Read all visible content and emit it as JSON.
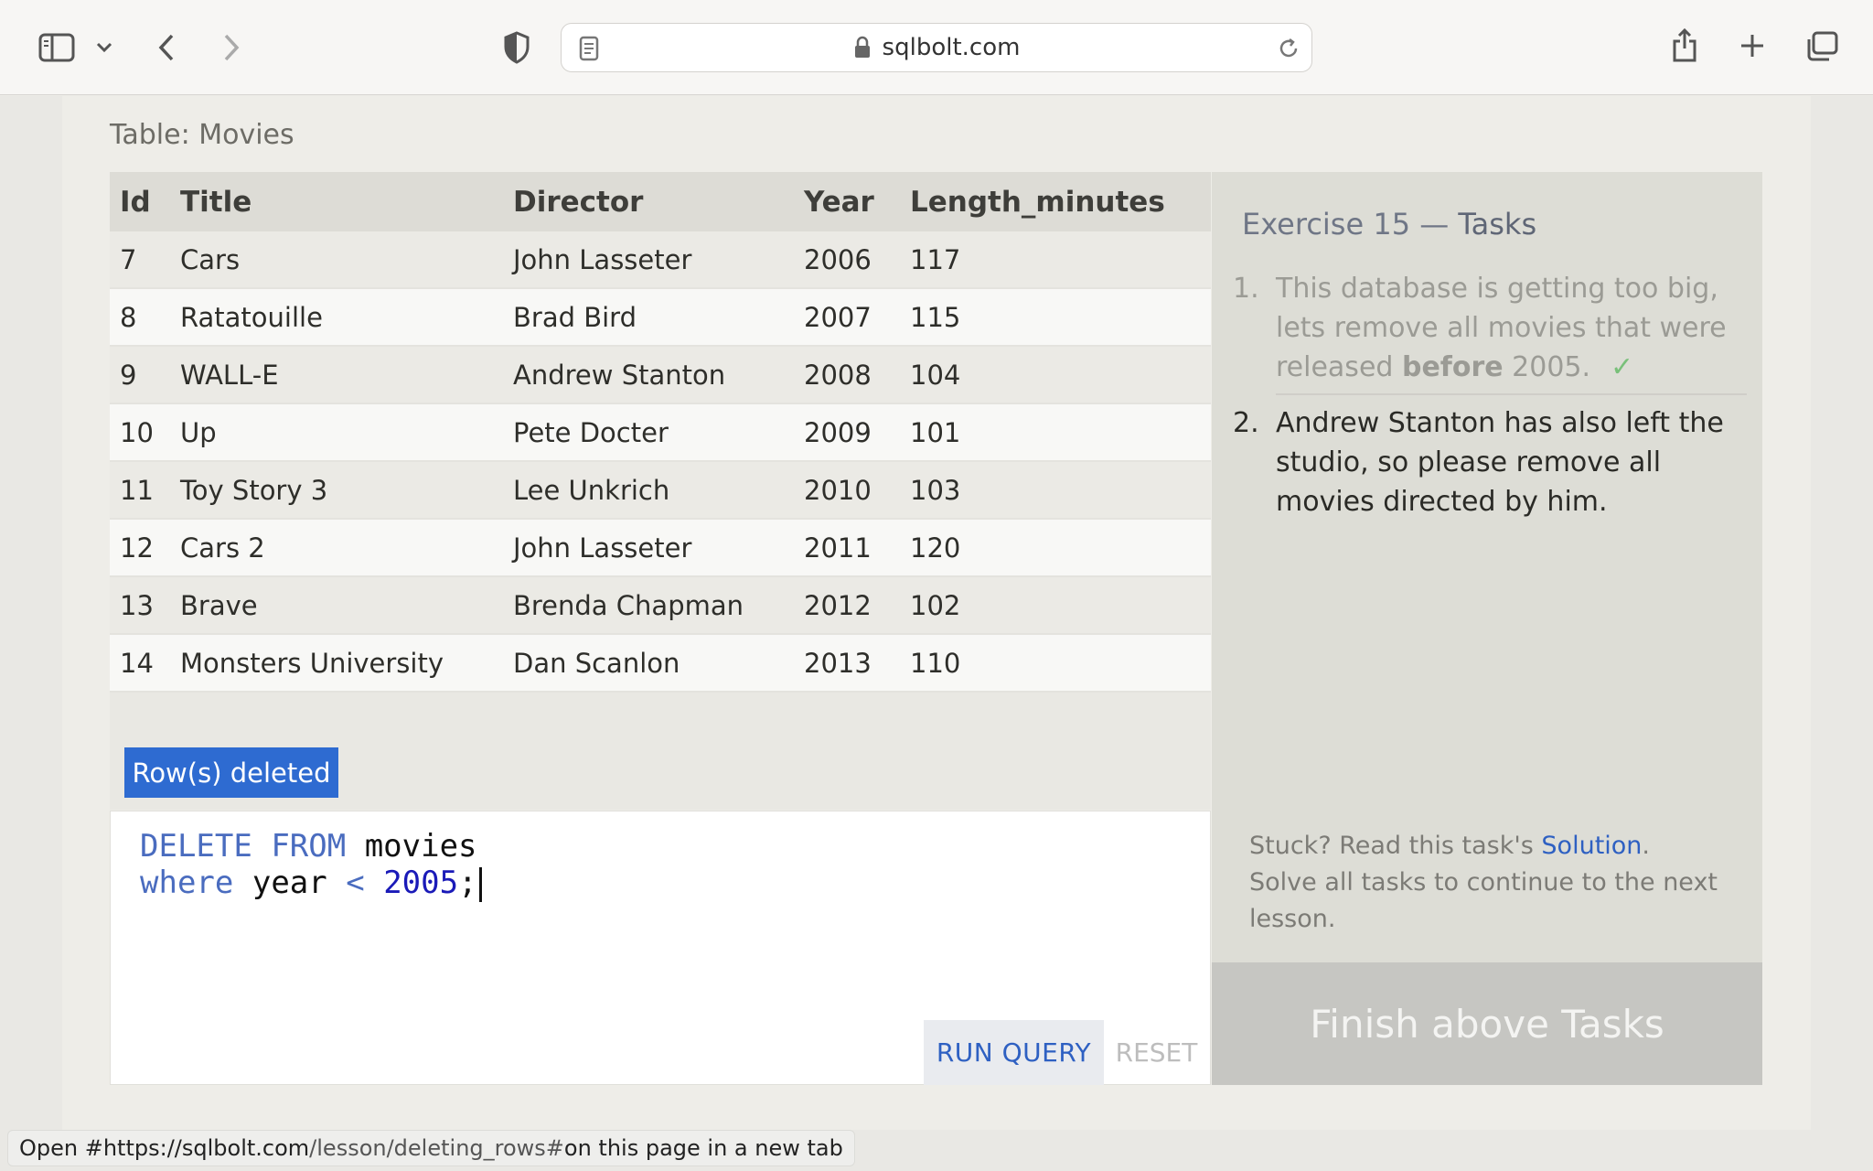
{
  "browser": {
    "url": "sqlbolt.com",
    "icons": [
      "sidebar-icon",
      "chevron-down-icon",
      "back-icon",
      "forward-icon",
      "shield-icon",
      "reader-icon",
      "lock-icon",
      "reload-icon",
      "share-icon",
      "new-tab-icon",
      "tabs-overview-icon"
    ]
  },
  "table": {
    "caption": "Table: Movies",
    "columns": [
      "Id",
      "Title",
      "Director",
      "Year",
      "Length_minutes"
    ],
    "rows": [
      [
        "7",
        "Cars",
        "John Lasseter",
        "2006",
        "117"
      ],
      [
        "8",
        "Ratatouille",
        "Brad Bird",
        "2007",
        "115"
      ],
      [
        "9",
        "WALL-E",
        "Andrew Stanton",
        "2008",
        "104"
      ],
      [
        "10",
        "Up",
        "Pete Docter",
        "2009",
        "101"
      ],
      [
        "11",
        "Toy Story 3",
        "Lee Unkrich",
        "2010",
        "103"
      ],
      [
        "12",
        "Cars 2",
        "John Lasseter",
        "2011",
        "120"
      ],
      [
        "13",
        "Brave",
        "Brenda Chapman",
        "2012",
        "102"
      ],
      [
        "14",
        "Monsters University",
        "Dan Scanlon",
        "2013",
        "110"
      ]
    ]
  },
  "status": {
    "message": "Row(s) deleted",
    "color": "#2e6bd1"
  },
  "editor": {
    "line1": {
      "kw1": "DELETE",
      "kw2": "FROM",
      "table": "movies"
    },
    "line2": {
      "kw": "where",
      "col": "year",
      "op": "<",
      "num": "2005",
      "end": ";"
    },
    "run_label": "RUN QUERY",
    "reset_label": "RESET"
  },
  "tasks": {
    "title_prefix": "Exercise 15 — ",
    "title_strong": "Tasks",
    "items": [
      {
        "num": "1.",
        "text_a": "This database is getting too big, lets remove all movies that were released ",
        "text_bold": "before",
        "text_b": " 2005.",
        "check": "✓"
      },
      {
        "num": "2.",
        "text": "Andrew Stanton has also left the studio, so please remove all movies directed by him."
      }
    ],
    "hint_prefix": "Stuck? Read this task's ",
    "hint_link": "Solution",
    "hint_suffix": ".",
    "hint_line2": "Solve all tasks to continue to the next lesson.",
    "finish_label": "Finish above Tasks"
  },
  "statusbar": {
    "prefix": "Open #",
    "host": "https://sqlbolt.com",
    "path": "/lesson/deleting_rows#",
    "suffix": " on this page in a new tab"
  }
}
